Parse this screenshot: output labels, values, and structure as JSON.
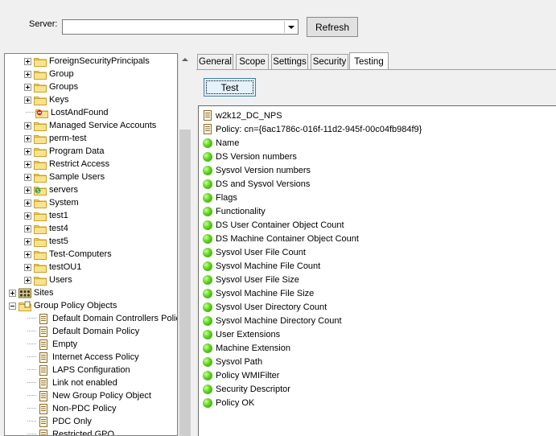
{
  "toolbar": {
    "server_label": "Server:",
    "server_value": "",
    "refresh_label": "Refresh"
  },
  "tree": {
    "items": [
      {
        "label": "ForeignSecurityPrincipals",
        "icon": "folder-icon"
      },
      {
        "label": "Group",
        "icon": "folder-icon"
      },
      {
        "label": "Groups",
        "icon": "folder-icon"
      },
      {
        "label": "Keys",
        "icon": "folder-icon"
      },
      {
        "label": "LostAndFound",
        "icon": "lostandfound-folder-icon"
      },
      {
        "label": "Managed Service Accounts",
        "icon": "folder-icon"
      },
      {
        "label": "perm-test",
        "icon": "folder-icon"
      },
      {
        "label": "Program Data",
        "icon": "folder-icon"
      },
      {
        "label": "Restrict Access",
        "icon": "folder-icon"
      },
      {
        "label": "Sample Users",
        "icon": "folder-icon"
      },
      {
        "label": "servers",
        "icon": "ou-folder-icon"
      },
      {
        "label": "System",
        "icon": "folder-icon"
      },
      {
        "label": "test1",
        "icon": "folder-icon"
      },
      {
        "label": "test4",
        "icon": "folder-icon"
      },
      {
        "label": "test5",
        "icon": "folder-icon"
      },
      {
        "label": "Test-Computers",
        "icon": "folder-icon"
      },
      {
        "label": "testOU1",
        "icon": "folder-icon"
      },
      {
        "label": "Users",
        "icon": "folder-icon"
      },
      {
        "label": "Sites",
        "icon": "sites-icon"
      },
      {
        "label": "Group Policy Objects",
        "icon": "gpo-folder-icon"
      },
      {
        "label": "Default Domain Controllers Policy",
        "icon": "gpo-icon"
      },
      {
        "label": "Default Domain Policy",
        "icon": "gpo-icon"
      },
      {
        "label": "Empty",
        "icon": "gpo-icon"
      },
      {
        "label": "Internet Access Policy",
        "icon": "gpo-icon"
      },
      {
        "label": "LAPS Configuration",
        "icon": "gpo-icon"
      },
      {
        "label": "Link not enabled",
        "icon": "gpo-icon"
      },
      {
        "label": "New Group Policy Object",
        "icon": "gpo-icon"
      },
      {
        "label": "Non-PDC Policy",
        "icon": "gpo-icon"
      },
      {
        "label": "PDC Only",
        "icon": "gpo-icon"
      },
      {
        "label": "Restricted GPO",
        "icon": "gpo-icon"
      }
    ]
  },
  "tabs": [
    "General",
    "Scope",
    "Settings",
    "Security",
    "Testing"
  ],
  "active_tab": "Testing",
  "test_button_label": "Test",
  "results": {
    "header": [
      "w2k12_DC_NPS",
      "Policy: cn={6ac1786c-016f-11d2-945f-00c04fb984f9}"
    ],
    "checks": [
      "Name",
      "DS Version numbers",
      "Sysvol Version numbers",
      "DS and Sysvol Versions",
      "Flags",
      "Functionality",
      "DS User Container Object Count",
      "DS Machine Container Object Count",
      "Sysvol User File Count",
      "Sysvol Machine File Count",
      "Sysvol User File Size",
      "Sysvol Machine File Size",
      "Sysvol User Directory Count",
      "Sysvol Machine Directory Count",
      "User Extensions",
      "Machine Extension",
      "Sysvol Path",
      "Policy WMIFilter",
      "Security Descriptor",
      "Policy OK"
    ],
    "status_color": "#3cb80e"
  }
}
